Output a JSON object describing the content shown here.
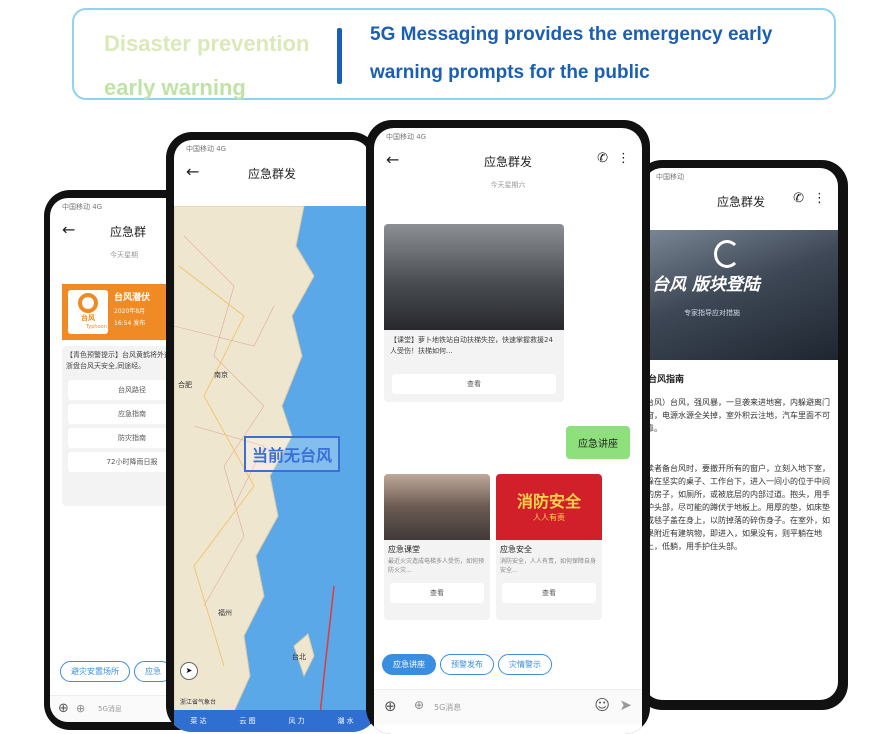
{
  "banner": {
    "left_line1": "Disaster prevention",
    "left_line2": "early warning",
    "right_line1": "5G Messaging provides the emergency early",
    "right_line2": "warning prompts for the public"
  },
  "phone1": {
    "status": "中国移动 4G",
    "title": "应急群",
    "date": "今天星期",
    "card_badge": "台风",
    "card_title": "台风潜伏",
    "card_meta1": "2020年8月",
    "card_meta2": "16:54 发布",
    "card_brand": "Typhoon",
    "card_text": "【青色预警提示】台风黄鹤将外速德徽达浙盘台风天安全,同途经。",
    "buttons": [
      "台风路径",
      "应急指南",
      "防灾指南",
      "72小时降雨日报"
    ],
    "chip1": "避灾安置场所",
    "chip2": "应急",
    "input_placeholder": "5G消息"
  },
  "phone2": {
    "status": "中国移动 4G",
    "title": "应急群发",
    "stamp": "当前无台风",
    "map_label_cities": [
      "南京",
      "合肥",
      "福州",
      "台北"
    ],
    "credit": "浙江省气象台",
    "tabs": [
      "菜 达",
      "云 图",
      "风 力",
      "潮 水"
    ]
  },
  "phone3": {
    "status": "中国移动 4G",
    "title": "应急群发",
    "date": "今天星期六",
    "news_text": "【课堂】萝卜地铁站自动扶梯失控，快速掌握救援24人受伤！扶梯如何...",
    "news_btn": "查看",
    "bubble": "应急讲座",
    "card1_title": "应急课堂",
    "card1_text": "最近火灾造成电梯多人受伤，如何预防火灾...",
    "card1_btn": "查看",
    "card2_img": "消防安全",
    "card2_img_sub": "人人有责",
    "card2_title": "应急安全",
    "card2_text": "消防安全，人人有责，如何保障自身安全...",
    "card2_btn": "查看",
    "chips": [
      "应急讲座",
      "预警发布",
      "灾情警示"
    ],
    "input_placeholder": "5G消息"
  },
  "phone4": {
    "status": "中国移动",
    "title": "应急群发",
    "hero_text": "台风 版块登陆",
    "hero_sub": "专家指导应对措施",
    "heading": "台风指南",
    "para1": "台风）台风，强风暴，一旦袭来进地窖，内躲避离门窗，电源水源全关掉，室外积云注地，汽车里面不可靠。",
    "para2": "读者备台风时，要撤开所有的窗户，立刻入地下室，躲在坚实的桌子、工作台下，进入一间小的位于中间的房子，如厕所，或被底层的内部过道。抱头，用手护头部，尽可能的蹲伏于地板上。用厚的垫，如床垫或毯子盖在身上，以防掉落的碎伤身子。在室外，如果附近有建筑物，即进入，如果没有，则平躺在地上，低躺，用手护住头部。"
  },
  "colors": {
    "accent": "#3a8ee0",
    "banner_border": "#8fd3ef",
    "banner_text": "#1a5fb4",
    "bubble": "#8ee07d",
    "map_sea": "#5aa8e8",
    "alert_orange": "#f08a24"
  }
}
